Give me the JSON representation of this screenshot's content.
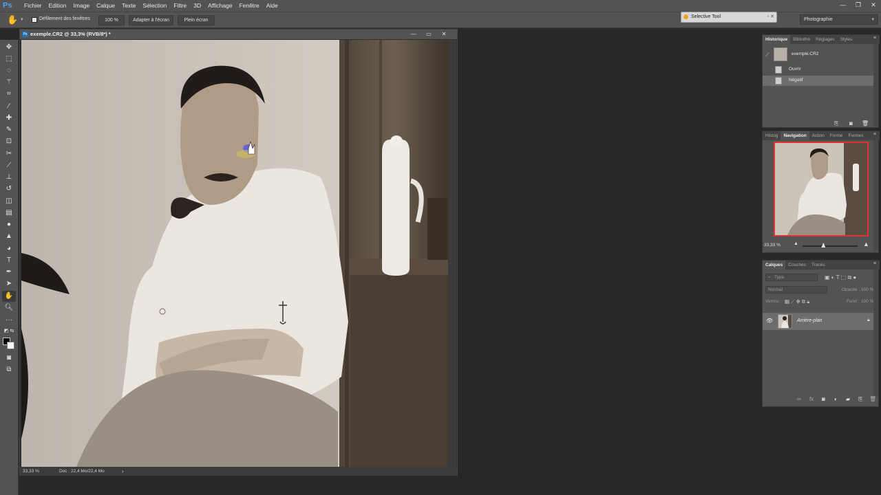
{
  "app": {
    "logo": "Ps"
  },
  "menu": [
    "Fichier",
    "Edition",
    "Image",
    "Calque",
    "Texte",
    "Sélection",
    "Filtre",
    "3D",
    "Affichage",
    "Fenêtre",
    "Aide"
  ],
  "window_controls": {
    "minimize": "—",
    "maximize": "❐",
    "close": "✕"
  },
  "options": {
    "scroll_all_label": "Défilement des fenêtres",
    "scroll_all_checked": true,
    "zoom_button": "100 %",
    "fit_button": "Adapter à l'écran",
    "fill_button": "Plein écran"
  },
  "plugin": {
    "title": "Selective Tool"
  },
  "workspace": {
    "selected": "Photographie"
  },
  "document": {
    "icon": "Ps",
    "title": "exemple.CR2 @ 33,3% (RVB/8*) *",
    "status_zoom": "33,33 %",
    "status_doc": "Doc : 22,4 Mo/22,4 Mo",
    "status_arrow": "›"
  },
  "tools": [
    "move-icon",
    "marquee-icon",
    "lasso-icon",
    "magic-wand-icon",
    "crop-icon",
    "eyedropper-icon",
    "healing-brush-icon",
    "brush-icon",
    "clone-stamp-icon",
    "history-brush-icon",
    "eraser-icon",
    "gradient-icon",
    "blur-icon",
    "dodge-icon",
    "pen-icon",
    "type-icon",
    "path-selection-icon",
    "shape-icon",
    "hand-icon",
    "zoom-icon",
    "more-tools-icon",
    "quick-mask-icon",
    "screen-mode-icon"
  ],
  "history_panel": {
    "tabs": [
      "Historique",
      "Bibliothè",
      "Réglages",
      "Styles"
    ],
    "snapshot": "exemple.CR2",
    "steps": [
      {
        "label": "Ouvrir",
        "selected": false
      },
      {
        "label": "Négatif",
        "selected": true
      }
    ]
  },
  "navigator_panel": {
    "tabs": [
      "Histog",
      "Navigation",
      "Action",
      "Forme",
      "Formes"
    ],
    "zoom": "33,33 %",
    "zoom_slider_value": 0.33
  },
  "layers_panel": {
    "tabs": [
      "Calques",
      "Couches",
      "Tracés"
    ],
    "filter_placeholder": "Type",
    "blend_mode": "Normal",
    "opacity_label": "Opacité :",
    "opacity_value": "100 %",
    "lock_label": "Verrou :",
    "fill_label": "Fond :",
    "fill_value": "100 %",
    "layers": [
      {
        "name": "Arrière-plan",
        "visible": true,
        "locked": true
      }
    ]
  },
  "colors": {
    "accent_blue": "#4ca6e8",
    "nav_frame": "#e23232",
    "foreground": "#000000",
    "background": "#ffffff"
  }
}
